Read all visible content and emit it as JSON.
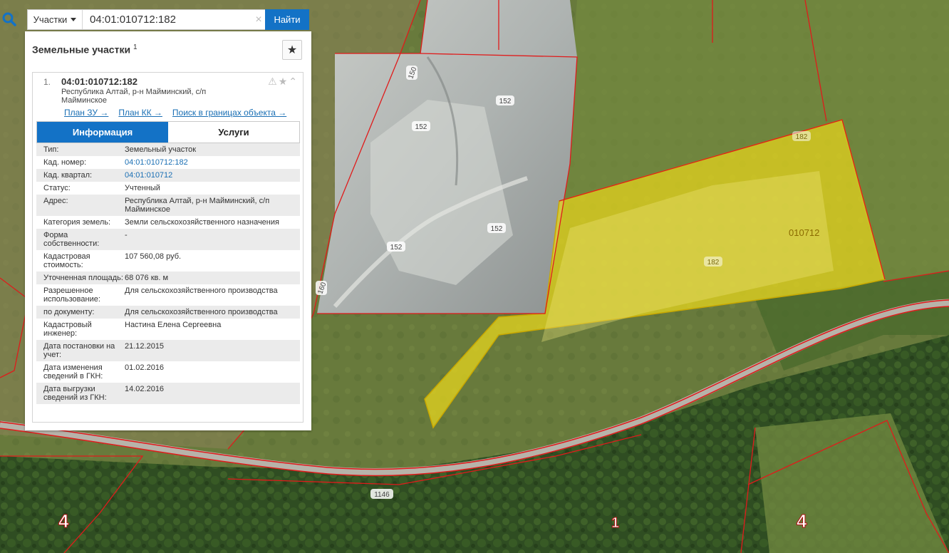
{
  "search": {
    "type_label": "Участки",
    "query": "04:01:010712:182",
    "clear_glyph": "×",
    "find_label": "Найти"
  },
  "panel": {
    "title": "Земельные участки",
    "count": "1",
    "star_glyph": "★"
  },
  "result": {
    "number": "1.",
    "cad_number": "04:01:010712:182",
    "address": "Республика Алтай, р-н Майминский, с/п Майминское",
    "actions": [
      "⚠",
      "★",
      "⌃"
    ],
    "links": [
      "План ЗУ →",
      "План КК →",
      "Поиск в границах объекта →"
    ],
    "tabs": [
      "Информация",
      "Услуги"
    ],
    "rows": [
      {
        "k": "Тип:",
        "v": "Земельный участок"
      },
      {
        "k": "Кад. номер:",
        "v": "04:01:010712:182",
        "link": true
      },
      {
        "k": "Кад. квартал:",
        "v": "04:01:010712",
        "link": true
      },
      {
        "k": "Статус:",
        "v": "Учтенный"
      },
      {
        "k": "Адрес:",
        "v": "Республика Алтай, р-н Майминский, с/п Майминское"
      },
      {
        "k": "Категория земель:",
        "v": "Земли сельскохозяйственного назначения"
      },
      {
        "k": "Форма собственности:",
        "v": "-"
      },
      {
        "k": "Кадастровая стоимость:",
        "v": "107 560,08 руб."
      },
      {
        "k": "Уточненная площадь:",
        "v": "68 076 кв. м"
      },
      {
        "k": "Разрешенное использование:",
        "v": "Для сельскохозяйственного производства"
      },
      {
        "k": "по документу:",
        "v": "Для сельскохозяйственного производства"
      },
      {
        "k": "Кадастровый инженер:",
        "v": "Настина Елена Сергеевна"
      },
      {
        "k": "Дата постановки на учет:",
        "v": "21.12.2015"
      },
      {
        "k": "Дата изменения сведений в ГКН:",
        "v": "01.02.2016"
      },
      {
        "k": "Дата выгрузки сведений из ГКН:",
        "v": "14.02.2016"
      }
    ]
  },
  "map": {
    "parcel_labels": [
      "150",
      "152",
      "152",
      "152",
      "152",
      "160",
      "182",
      "182",
      "010712",
      "1146"
    ],
    "zone_labels": [
      "4",
      "1",
      "4"
    ],
    "colors": {
      "highlight": "#e6d61e",
      "boundary": "#e01b1b"
    }
  }
}
